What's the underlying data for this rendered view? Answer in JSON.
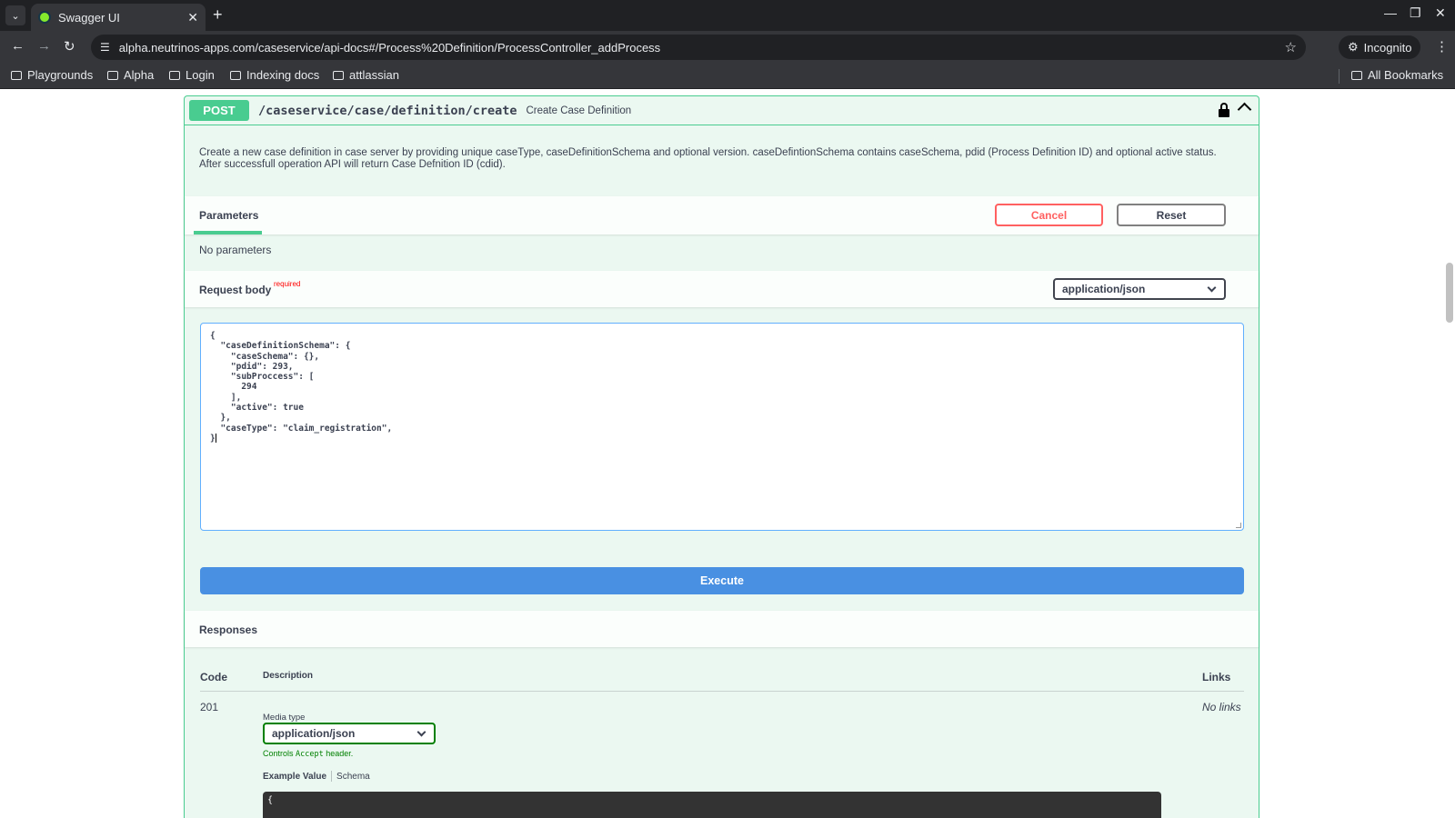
{
  "browser": {
    "tab_title": "Swagger UI",
    "url": "alpha.neutrinos-apps.com/caseservice/api-docs#/Process%20Definition/ProcessController_addProcess",
    "incognito_label": "Incognito",
    "bookmarks": [
      "Playgrounds",
      "Alpha",
      "Login",
      "Indexing docs",
      "attlassian"
    ],
    "all_bookmarks_label": "All Bookmarks"
  },
  "operation": {
    "method": "POST",
    "path": "/caseservice/case/definition/create",
    "summary": "Create Case Definition",
    "description_line1": "Create a new case definition in case server by providing unique caseType, caseDefinitionSchema and optional version. caseDefintionSchema contains caseSchema, pdid (Process Definition ID) and optional active status.",
    "description_line2": "After successfull operation API will return Case Defnition ID (cdid)."
  },
  "parameters": {
    "tab_label": "Parameters",
    "cancel_label": "Cancel",
    "reset_label": "Reset",
    "no_params_text": "No parameters"
  },
  "request_body": {
    "title": "Request body",
    "required_label": "required",
    "content_type": "application/json",
    "editor_text": "{\n  \"caseDefinitionSchema\": {\n    \"caseSchema\": {},\n    \"pdid\": 293,\n    \"subProccess\": [\n      294\n    ],\n    \"active\": true\n  },\n  \"caseType\": \"claim_registration\",\n}"
  },
  "execute_label": "Execute",
  "responses": {
    "title": "Responses",
    "col_code": "Code",
    "col_description": "Description",
    "col_links": "Links",
    "row": {
      "code": "201",
      "links": "No links",
      "media_type_label": "Media type",
      "media_type_value": "application/json",
      "controls_prefix": "Controls",
      "controls_code": "Accept",
      "controls_suffix": "header.",
      "example_value_tab": "Example Value",
      "schema_tab": "Schema",
      "example_first_line": "{"
    }
  },
  "icons": {
    "tab_list": "chevron-down-icon",
    "favicon": "swagger-icon",
    "close": "close-icon",
    "new_tab": "plus-icon",
    "back": "arrow-left-icon",
    "forward": "arrow-right-icon",
    "reload": "reload-icon",
    "site_info": "tune-icon",
    "bookmark_star": "star-icon",
    "incognito": "incognito-icon",
    "menu": "kebab-icon",
    "lock": "lock-icon",
    "collapse": "chevron-up-icon"
  },
  "colors": {
    "post_green": "#49cc90",
    "execute_blue": "#4990e2",
    "cancel_red": "#ff6060",
    "opblock_bg": "#ebf8f1"
  }
}
